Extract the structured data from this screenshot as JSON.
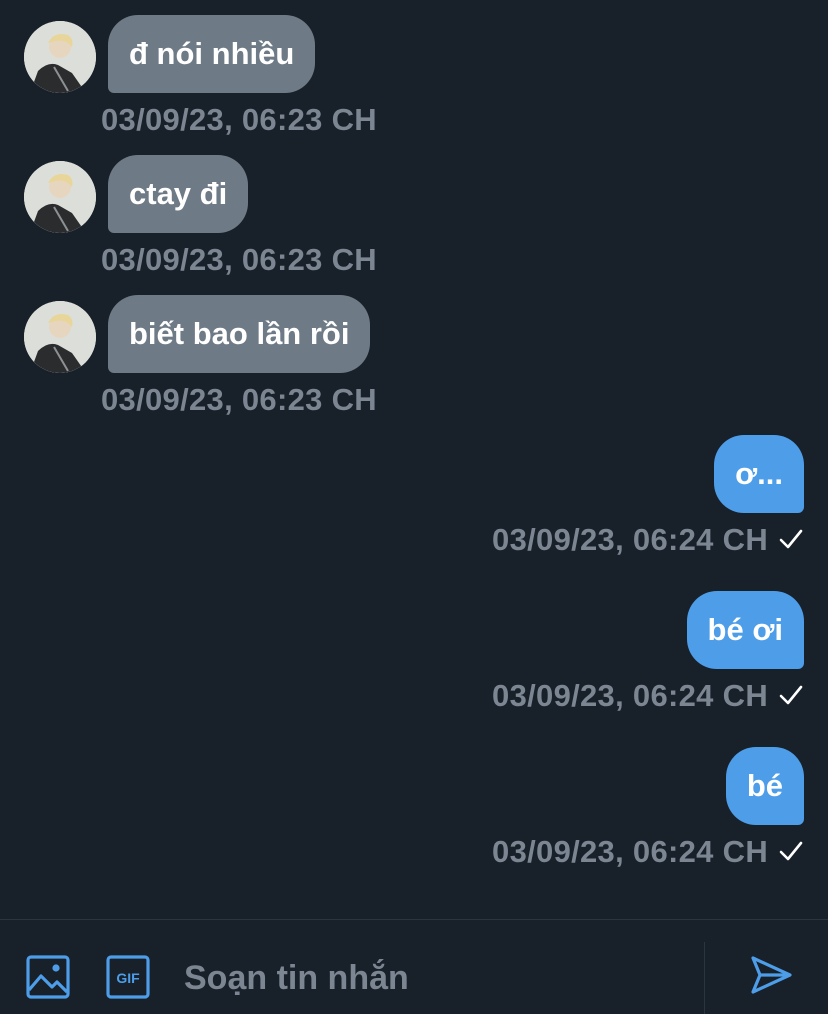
{
  "conversation": {
    "messages": [
      {
        "text": "đ nói nhiều",
        "timestamp": "03/09/23, 06:23 CH",
        "direction": "incoming"
      },
      {
        "text": "ctay đi",
        "timestamp": "03/09/23, 06:23 CH",
        "direction": "incoming"
      },
      {
        "text": "biết bao lần rồi",
        "timestamp": "03/09/23, 06:23 CH",
        "direction": "incoming"
      },
      {
        "text": "ơ...",
        "timestamp": "03/09/23, 06:24 CH",
        "direction": "outgoing",
        "status_icon": "check-icon"
      },
      {
        "text": "bé ơi",
        "timestamp": "03/09/23, 06:24 CH",
        "direction": "outgoing",
        "status_icon": "check-icon"
      },
      {
        "text": "bé",
        "timestamp": "03/09/23, 06:24 CH",
        "direction": "outgoing",
        "status_icon": "check-icon"
      }
    ]
  },
  "composer": {
    "placeholder": "Soạn tin nhắn",
    "image_button_icon": "image-icon",
    "gif_button_icon": "gif-icon",
    "gif_label": "GIF",
    "send_button_icon": "send-icon"
  },
  "colors": {
    "background": "#182029",
    "incoming_bubble": "#6e7a86",
    "outgoing_bubble": "#4d9de8",
    "timestamp": "#7b8692",
    "accent": "#4d9de8"
  }
}
